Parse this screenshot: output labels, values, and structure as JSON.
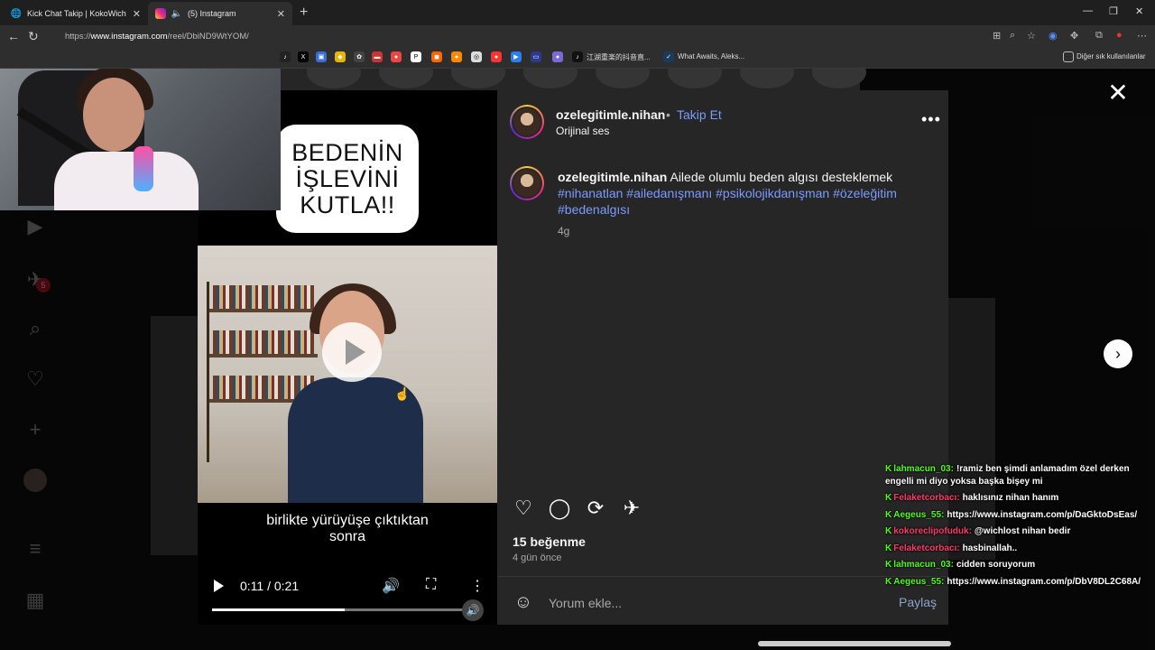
{
  "browser": {
    "tabs": [
      {
        "title": "Kick Chat Takip | KokoWich",
        "icon": "globe-icon"
      },
      {
        "title": "(5) Instagram",
        "icon": "instagram-icon"
      }
    ],
    "url_prefix": "https://",
    "url_domain": "www.instagram.com",
    "url_path": "/reel/DbiND9WtYOM/",
    "bookmarks": [
      {
        "label": "江湖重楽的抖音直..."
      },
      {
        "label": "What Awaits, Aleks..."
      },
      {
        "label": "Diğer sık kullanılanlar"
      }
    ]
  },
  "sidebar": {
    "messages_badge": "5"
  },
  "reel": {
    "overlay_text": "BEDENİN\nİŞLEVİNİ\nKUTLA!!",
    "subtitle": "birlikte yürüyüşe çıktıktan\nsonra",
    "time": "0:11 / 0:21",
    "progress": 0.524
  },
  "post": {
    "username": "ozelegitimle.nihan",
    "dot": "•",
    "follow": "Takip Et",
    "audio": "Orijinal ses",
    "caption_user": "ozelegitimle.nihan",
    "caption_text": "Ailede olumlu beden algısı desteklemek",
    "caption_tags": "#nihanatlan #ailedanışmanı #psikolojikdanışman #özeleğitim #bedenalgısı",
    "caption_age": "4g",
    "likes": "15 beğenme",
    "posted": "4 gün önce",
    "comment_placeholder": "Yorum ekle...",
    "share": "Paylaş",
    "more": "•••"
  },
  "chat": [
    {
      "badges": "K",
      "user": "lahmacun_03:",
      "user_color": "#53fc18",
      "text": "!ramiz ben şimdi anlamadım özel derken engelli mi diyo yoksa başka bişey mi",
      "wrap": true
    },
    {
      "badges": "K",
      "user": "Felaketcorbacı:",
      "user_color": "#ff3b6b",
      "text": "haklısınız nihan hanım",
      "wrap": false
    },
    {
      "badges": "K",
      "user": "Aegeus_55:",
      "user_color": "#53fc18",
      "text": "https://www.instagram.com/p/DaGktoDsEas/",
      "wrap": false
    },
    {
      "badges": "K",
      "user": "kokoreclipofuduk:",
      "user_color": "#ff3b6b",
      "text": "@wichlost nihan bedir",
      "wrap": false
    },
    {
      "badges": "K",
      "user": "Felaketcorbacı:",
      "user_color": "#ff3b6b",
      "text": "hasbinallah..",
      "wrap": false
    },
    {
      "badges": "K",
      "user": "lahmacun_03:",
      "user_color": "#53fc18",
      "text": "cidden soruyorum",
      "wrap": false
    },
    {
      "badges": "K",
      "user": "Aegeus_55:",
      "user_color": "#53fc18",
      "text": "https://www.instagram.com/p/DbV8DL2C68A/",
      "wrap": false
    }
  ]
}
